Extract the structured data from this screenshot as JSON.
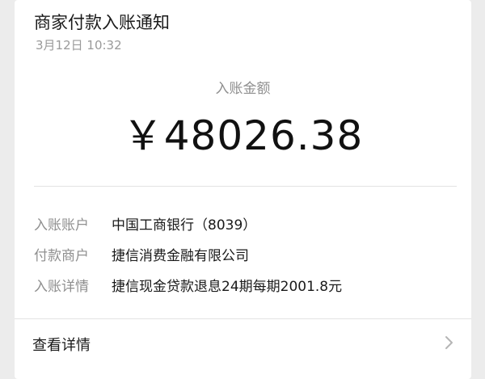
{
  "notification": {
    "title": "商家付款入账通知",
    "timestamp": "3月12日 10:32"
  },
  "amount": {
    "label": "入账金额",
    "value": "￥48026.38"
  },
  "details": [
    {
      "label": "入账账户",
      "value": "中国工商银行（8039）"
    },
    {
      "label": "付款商户",
      "value": "捷信消费金融有限公司"
    },
    {
      "label": "入账详情",
      "value": "捷信现金贷款退息24期每期2001.8元"
    }
  ],
  "footer": {
    "view_details_label": "查看详情",
    "chevron_icon": "chevron-right-icon"
  },
  "colors": {
    "background": "#ececec",
    "card": "#ffffff",
    "muted_text": "#8f8f8f",
    "primary_text": "#1a1a1a"
  }
}
